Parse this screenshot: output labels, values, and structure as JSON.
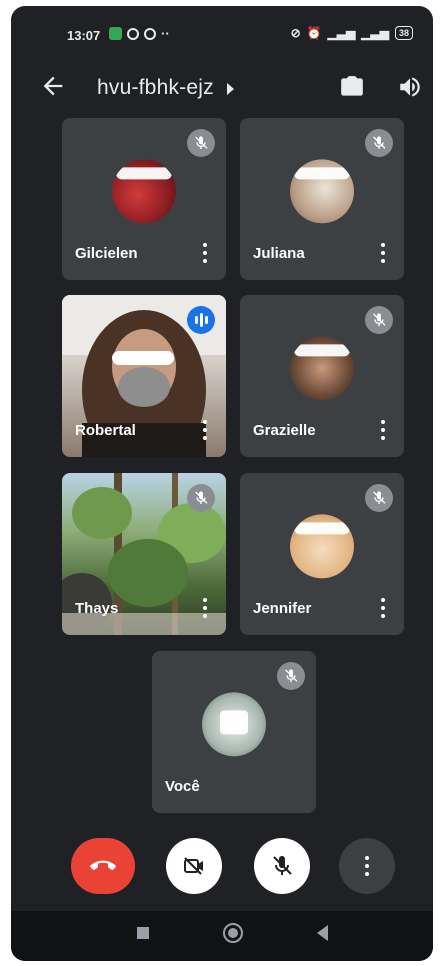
{
  "status_bar": {
    "time": "13:07",
    "battery": "38"
  },
  "header": {
    "meeting_code": "hvu-fbhk-ejz"
  },
  "participants": [
    {
      "name": "Gilcielen",
      "muted": true,
      "speaking": false,
      "video": false,
      "avatar_color": "#b3262d"
    },
    {
      "name": "Juliana",
      "muted": true,
      "speaking": false,
      "video": false,
      "avatar_color": "#d9c8b8"
    },
    {
      "name": "Robertal",
      "muted": false,
      "speaking": true,
      "video": true,
      "avatar_color": "#6b4b37"
    },
    {
      "name": "Grazielle",
      "muted": true,
      "speaking": false,
      "video": false,
      "avatar_color": "#6e5a4a"
    },
    {
      "name": "Thays",
      "muted": true,
      "speaking": false,
      "video": true,
      "avatar_color": "#6f8a55"
    },
    {
      "name": "Jennifer",
      "muted": true,
      "speaking": false,
      "video": false,
      "avatar_color": "#e8c49a"
    },
    {
      "name": "Você",
      "muted": true,
      "speaking": false,
      "video": false,
      "avatar_color": "#cfd8d4"
    }
  ],
  "colors": {
    "background": "#202124",
    "tile": "#3c4043",
    "end_call": "#ea4335",
    "speaking_badge": "#1a73e8"
  },
  "icons": {
    "back": "arrow-left-icon",
    "switch_camera": "switch-camera-icon",
    "audio": "speaker-icon",
    "end_call": "phone-hangup-icon",
    "camera": "camera-off-icon",
    "mic": "mic-off-icon",
    "more": "more-vert-icon"
  }
}
